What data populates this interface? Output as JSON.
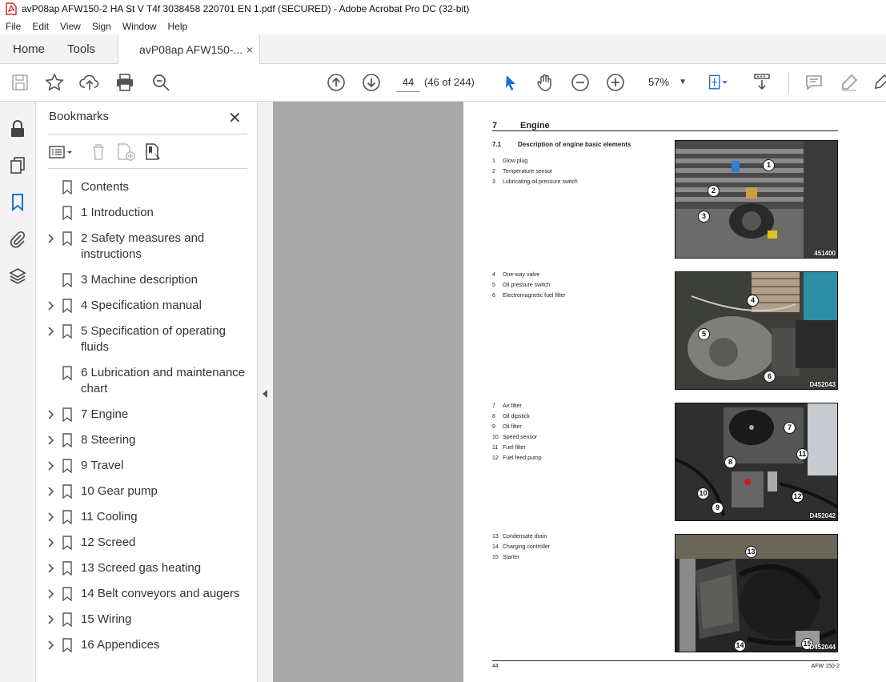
{
  "window": {
    "title": "avP08ap AFW150-2 HA St V T4f 3038458 220701 EN 1.pdf (SECURED) - Adobe Acrobat Pro DC (32-bit)"
  },
  "menu": [
    "File",
    "Edit",
    "View",
    "Sign",
    "Window",
    "Help"
  ],
  "tabs": {
    "home": "Home",
    "tools": "Tools",
    "doc": "avP08ap AFW150-...",
    "doc_close": "×"
  },
  "toolbar": {
    "page_number": "44",
    "page_count": "(46 of 244)",
    "zoom": "57%"
  },
  "bookmarks": {
    "title": "Bookmarks",
    "close": "✕",
    "items": [
      {
        "label": "Contents",
        "expandable": false
      },
      {
        "label": "1 Introduction",
        "expandable": false
      },
      {
        "label": "2 Safety measures and instructions",
        "expandable": true
      },
      {
        "label": "3 Machine description",
        "expandable": false
      },
      {
        "label": "4 Specification manual",
        "expandable": true
      },
      {
        "label": "5 Specification of operating fluids",
        "expandable": true
      },
      {
        "label": "6 Lubrication and maintenance chart",
        "expandable": false
      },
      {
        "label": "7 Engine",
        "expandable": true
      },
      {
        "label": "8 Steering",
        "expandable": true
      },
      {
        "label": "9 Travel",
        "expandable": true
      },
      {
        "label": "10 Gear pump",
        "expandable": true
      },
      {
        "label": "11 Cooling",
        "expandable": true
      },
      {
        "label": "12 Screed",
        "expandable": true
      },
      {
        "label": "13 Screed gas heating",
        "expandable": true
      },
      {
        "label": "14 Belt conveyors and augers",
        "expandable": true
      },
      {
        "label": "15 Wiring",
        "expandable": true
      },
      {
        "label": "16 Appendices",
        "expandable": true
      }
    ]
  },
  "document": {
    "section_number": "7",
    "section_title": "Engine",
    "subsection_number": "7.1",
    "subsection_title": "Description of engine basic elements",
    "groups": [
      {
        "items": [
          {
            "n": "1",
            "t": "Glow plug"
          },
          {
            "n": "2",
            "t": "Temperature sensor"
          },
          {
            "n": "3",
            "t": "Lubricating oil pressure switch"
          }
        ],
        "photo_code": "451400",
        "callouts": [
          "1",
          "2",
          "3"
        ]
      },
      {
        "items": [
          {
            "n": "4",
            "t": "One-way valve"
          },
          {
            "n": "5",
            "t": "Oil pressure switch"
          },
          {
            "n": "6",
            "t": "Electromagnetic fuel filter"
          }
        ],
        "photo_code": "D452043",
        "callouts": [
          "4",
          "5",
          "6"
        ]
      },
      {
        "items": [
          {
            "n": "7",
            "t": "Air filter"
          },
          {
            "n": "8",
            "t": "Oil dipstick"
          },
          {
            "n": "9",
            "t": "Oil filter"
          },
          {
            "n": "10",
            "t": "Speed sensor"
          },
          {
            "n": "11",
            "t": "Fuel filter"
          },
          {
            "n": "12",
            "t": "Fuel feed pump"
          }
        ],
        "photo_code": "D452042",
        "callouts": [
          "7",
          "8",
          "9",
          "10",
          "11",
          "12"
        ]
      },
      {
        "items": [
          {
            "n": "13",
            "t": "Condensate drain"
          },
          {
            "n": "14",
            "t": "Charging controller"
          },
          {
            "n": "15",
            "t": "Starter"
          }
        ],
        "photo_code": "D452044",
        "callouts": [
          "13",
          "14",
          "15"
        ]
      }
    ],
    "footer_left": "44",
    "footer_right": "AFW 150-2"
  }
}
